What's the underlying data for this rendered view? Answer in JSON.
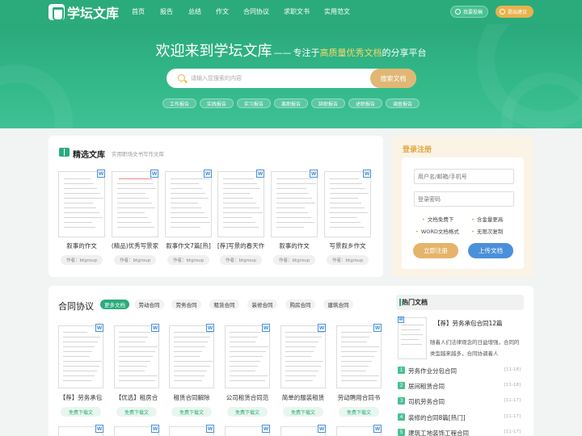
{
  "nav": {
    "logo": "学坛文库",
    "items": [
      "首页",
      "报告",
      "总结",
      "作文",
      "合同协议",
      "求职文书",
      "实用范文"
    ],
    "submit_label": "我要投稿",
    "suggest_label": "提出建议"
  },
  "hero": {
    "title": "欢迎来到学坛文库",
    "dash": "——",
    "subtitle_prefix": "专注于",
    "subtitle_highlight": "高质量优秀文档",
    "subtitle_suffix": "的分享平台",
    "search_placeholder": "请输入您搜索的内容",
    "search_button": "搜索文档",
    "tags": [
      "工作报告",
      "实践报告",
      "实习报告",
      "离职报告",
      "辞职报告",
      "述职报告",
      "调查报告"
    ]
  },
  "featured": {
    "title": "精选文库",
    "subtitle": "实用职场文书写作文库",
    "docs": [
      {
        "title": "叙事的作文",
        "author": "作者：btgroup"
      },
      {
        "title": "(精品)优秀写景家",
        "author": "作者：btgroup"
      },
      {
        "title": "叙事作文7篇[热]",
        "author": "作者：btgroup"
      },
      {
        "title": "[荐]写景的春天作",
        "author": "作者：btgroup"
      },
      {
        "title": "叙事的作文",
        "author": "作者：btgroup"
      },
      {
        "title": "写景叙乡作文",
        "author": "作者：btgroup"
      }
    ]
  },
  "login": {
    "title": "登录注册",
    "username_placeholder": "用户名/邮箱/手机号",
    "password_placeholder": "登录密码",
    "features": [
      "文档免费下",
      "含金量更高",
      "WORD文档格式",
      "无限次复制"
    ],
    "register_button": "立即注册",
    "upload_button": "上传文档"
  },
  "contract": {
    "title": "合同协议",
    "more_label": "更多文档",
    "tabs": [
      "劳动合同",
      "劳务合同",
      "租赁合同",
      "装修合同",
      "购房合同",
      "建筑合同"
    ],
    "docs": [
      {
        "title": "【荐】劳务承包",
        "download": "免费下载文"
      },
      {
        "title": "【优选】租房合",
        "download": "免费下载文"
      },
      {
        "title": "租赁合同解除",
        "download": "免费下载文"
      },
      {
        "title": "公司租赁合同范",
        "download": "免费下载文"
      },
      {
        "title": "简单的服装租赁",
        "download": "免费下载文"
      },
      {
        "title": "劳动聘用合同书",
        "download": "免费下载文"
      }
    ]
  },
  "hot": {
    "title": "热门文档",
    "featured_title": "【荐】劳务承包合同12篇",
    "featured_desc": "随着人们法律观念的日益增强，合同的类型越来越多，合同协调着人",
    "items": [
      {
        "num": "1",
        "text": "劳务作业分包合同",
        "date": "[11-18]"
      },
      {
        "num": "2",
        "text": "居间租赁合同",
        "date": "[11-18]"
      },
      {
        "num": "3",
        "text": "司机劳务合同",
        "date": "[11-17]"
      },
      {
        "num": "4",
        "text": "装修的合同8篇[热门]",
        "date": "[11-17]"
      },
      {
        "num": "5",
        "text": "建筑工地装饰工程合同",
        "date": "[11-17]"
      }
    ]
  }
}
